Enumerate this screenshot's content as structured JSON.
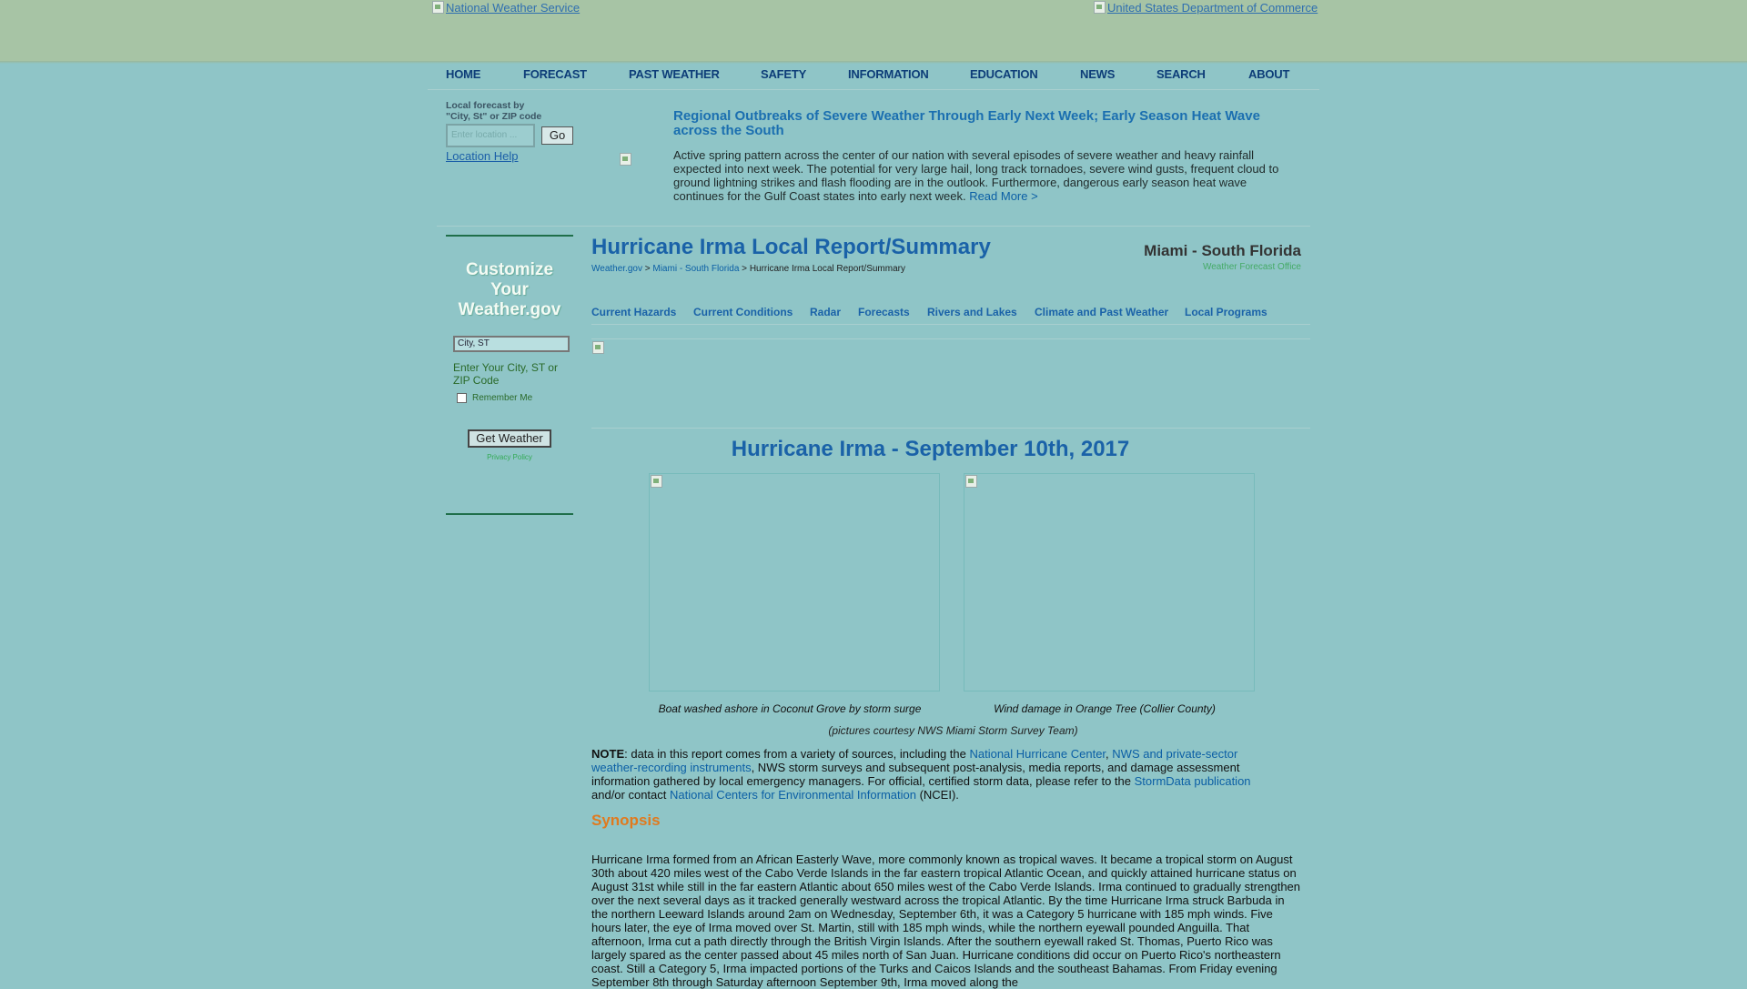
{
  "header": {
    "nws_link": "National Weather Service",
    "doc_link": "United States Department of Commerce"
  },
  "nav": {
    "items": [
      "HOME",
      "FORECAST",
      "PAST WEATHER",
      "SAFETY",
      "INFORMATION",
      "EDUCATION",
      "NEWS",
      "SEARCH",
      "ABOUT"
    ]
  },
  "local_forecast": {
    "label_line1": "Local forecast by",
    "label_line2": "\"City, St\" or ZIP code",
    "placeholder": "Enter location ...",
    "go_label": "Go",
    "help_link": "Location Help"
  },
  "outbreak": {
    "title": "Regional Outbreaks of Severe Weather Through Early Next Week; Early Season Heat Wave across the South",
    "body": "Active spring pattern across the center of our nation with several episodes of severe weather and heavy rainfall expected into next week. The potential for very large hail, long track tornadoes, severe wind gusts, frequent cloud to ground lightning strikes and flash flooding are in the outlook. Furthermore, dangerous early season heat wave continues for the Gulf Coast states into early next week.",
    "read_more": "Read More >"
  },
  "customize": {
    "title_line1": "Customize",
    "title_line2": "Your",
    "title_line3": "Weather.gov",
    "input_value": "City, ST",
    "hint": "Enter Your City, ST or ZIP Code",
    "remember": "Remember Me",
    "button": "Get Weather",
    "privacy": "Privacy Policy"
  },
  "page": {
    "title": "Hurricane Irma Local Report/Summary",
    "breadcrumb": {
      "home": "Weather.gov",
      "sep1": " > ",
      "office": "Miami - South Florida",
      "sep2": " > ",
      "current": "Hurricane Irma Local Report/Summary"
    },
    "office_name": "Miami - South Florida",
    "office_sub": "Weather Forecast Office"
  },
  "subnav": {
    "items": [
      "Current Hazards",
      "Current Conditions",
      "Radar",
      "Forecasts",
      "Rivers and Lakes",
      "Climate and Past Weather",
      "Local Programs"
    ]
  },
  "report": {
    "section_title": "Hurricane Irma - September 10th, 2017",
    "caption_left": "Boat washed ashore in Coconut Grove by storm surge",
    "caption_right": "Wind damage in Orange Tree (Collier County)",
    "courtesy": "(pictures courtesy NWS Miami Storm Survey Team)",
    "note": {
      "bold": "NOTE",
      "t1": ": data in this report comes from a variety of sources, including the ",
      "l1": "National Hurricane Center",
      "t2": ", ",
      "l2": "NWS and private-sector weather-recording instruments",
      "t3": ", NWS storm surveys and subsequent post-analysis, media reports, and damage assessment information gathered by local emergency managers. For official, certified storm data, please refer to the ",
      "l3": "StormData publication",
      "t4": " and/or contact ",
      "l4": "National Centers for Environmental Information",
      "t5": " (NCEI)."
    },
    "synopsis_title": "Synopsis",
    "synopsis_body": "Hurricane Irma formed from an African Easterly Wave, more commonly known as tropical waves. It became a tropical storm on August 30th about 420 miles west of the Cabo Verde Islands in the far eastern tropical Atlantic Ocean, and quickly attained hurricane status on August 31st while still in the far eastern Atlantic about 650 miles west of the Cabo Verde Islands. Irma continued to gradually strengthen over the next several days as it tracked generally westward across the tropical Atlantic. By the time Hurricane Irma struck Barbuda in the northern Leeward Islands around 2am on Wednesday, September 6th, it was a Category 5 hurricane with 185 mph winds.  Five hours later, the eye of Irma moved over St. Martin, still with 185 mph winds, while the northern eyewall pounded Anguilla.  That afternoon, Irma cut a path directly through the British Virgin Islands.  After the southern eyewall raked St. Thomas, Puerto Rico was largely spared as the center passed about 45 miles north of San Juan.  Hurricane conditions did occur on Puerto Rico's northeastern coast.  Still a Category 5, Irma impacted portions of the Turks and Caicos Islands and the southeast Bahamas.  From Friday evening September 8th through Saturday afternoon September 9th, Irma moved along the"
  }
}
